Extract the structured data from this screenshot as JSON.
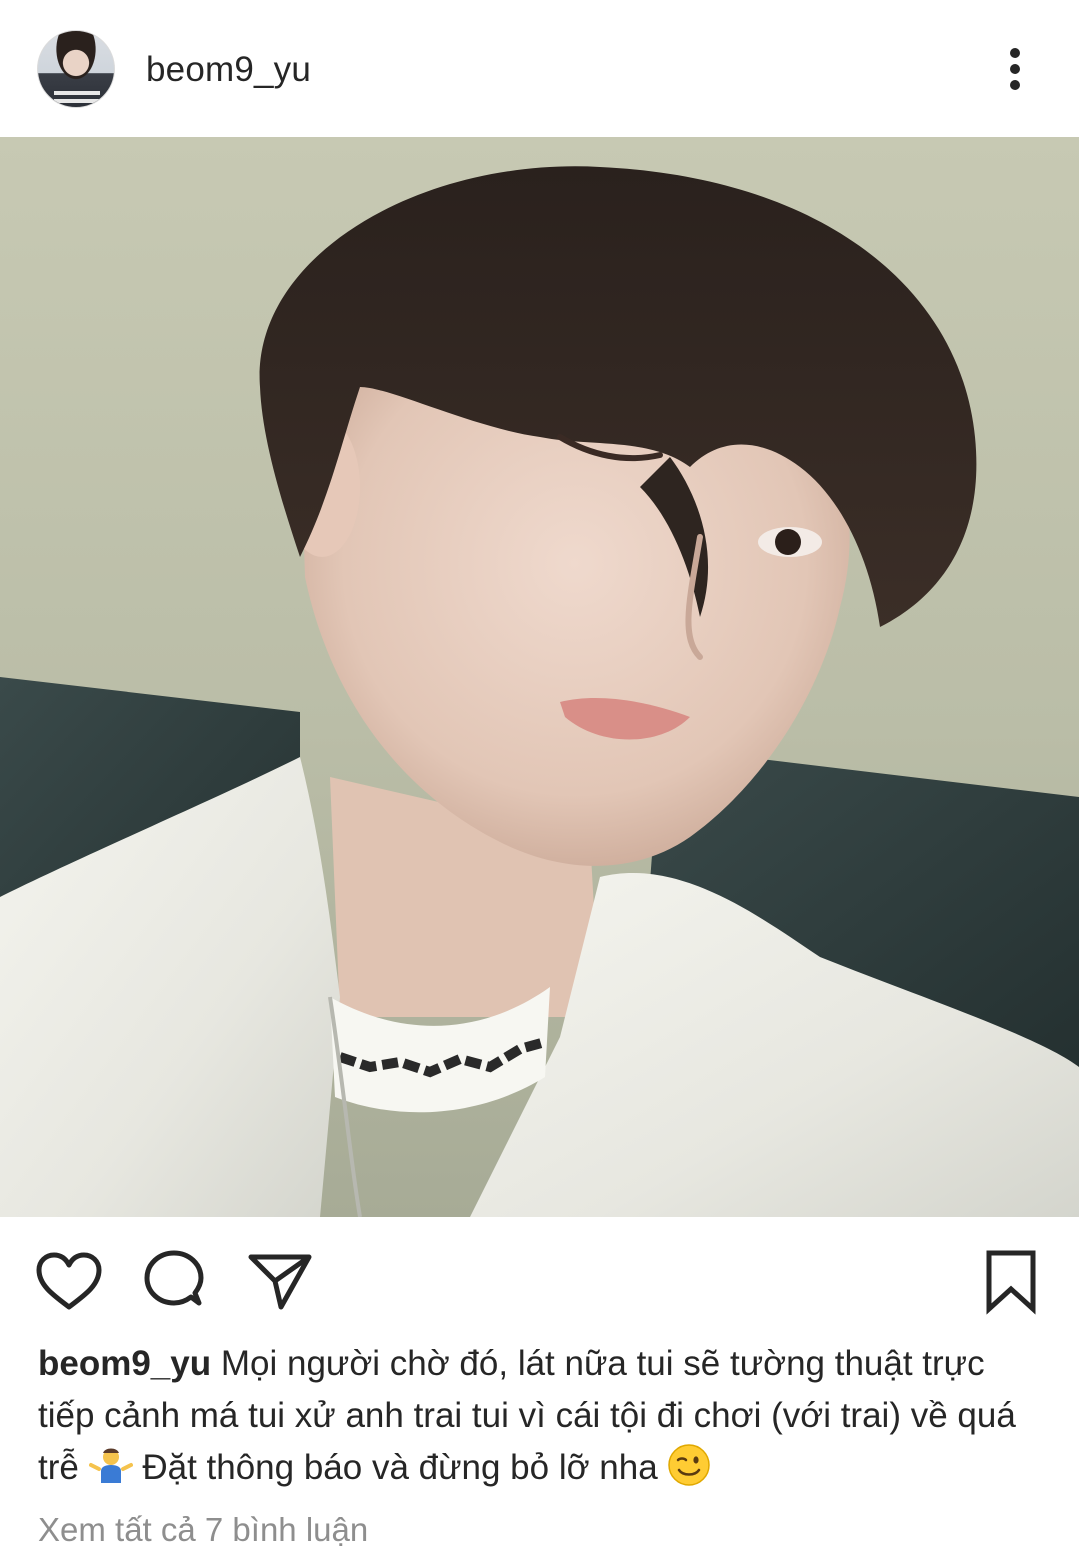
{
  "post": {
    "username": "beom9_yu",
    "caption_username": "beom9_yu",
    "caption_text_1": "Mọi người chờ đó, lát nữa tui sẽ tường thuật trực tiếp cảnh má tui xử anh trai tui vì cái tội đi chơi (với trai) về quá trễ",
    "caption_text_2": "Đặt thông báo và đừng bỏ lỡ nha",
    "view_comments": "Xem tất cả 7 bình luận"
  },
  "icons": {
    "more": "more-vertical-icon",
    "like": "heart-icon",
    "comment": "comment-bubble-icon",
    "share": "paper-plane-icon",
    "save": "bookmark-icon",
    "emoji_1": "person-shrugging-emoji",
    "emoji_2": "winking-face-emoji"
  },
  "colors": {
    "text": "#262626",
    "muted": "#8e8e8e",
    "background": "#ffffff"
  }
}
